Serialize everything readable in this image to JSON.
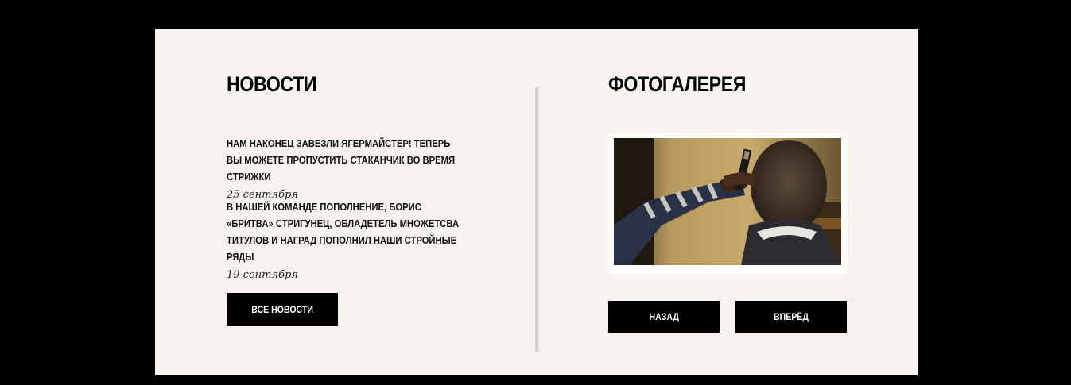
{
  "news": {
    "title": "НОВОСТИ",
    "items": [
      {
        "text": "НАМ НАКОНЕЦ ЗАВЕЗЛИ ЯГЕРМАЙСТЕР! ТЕПЕРЬ ВЫ МОЖЕТЕ ПРОПУСТИТЬ СТАКАНЧИК ВО ВРЕМЯ СТРИЖКИ",
        "date": "25 сентября"
      },
      {
        "text": "В НАШЕЙ КОМАНДЕ ПОПОЛНЕНИЕ, БОРИС «БРИТВА» СТРИГУНЕЦ, ОБЛАДЕТЕЛЬ МНОЖЕТСВА ТИТУЛОВ И НАГРАД ПОПОЛНИЛ НАШИ СТРОЙНЫЕ РЯДЫ",
        "date": "19 сентября"
      }
    ],
    "all_news_label": "ВСЕ НОВОСТИ"
  },
  "gallery": {
    "title": "ФОТОГАЛЕРЕЯ",
    "photo_icon": "barber-photo",
    "back_label": "НАЗАД",
    "forward_label": "ВПЕРЁД"
  },
  "colors": {
    "page_background": "#000000",
    "panel_background": "#f7f4f0",
    "button_background": "#000000",
    "button_text": "#ffffff"
  }
}
